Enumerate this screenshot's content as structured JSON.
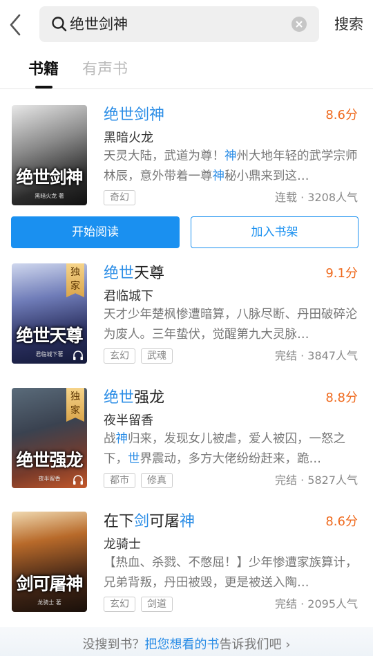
{
  "search": {
    "query": "绝世剑神",
    "button_label": "搜索"
  },
  "tabs": [
    {
      "label": "书籍"
    },
    {
      "label": "有声书"
    }
  ],
  "books": [
    {
      "title_parts": [
        {
          "text": "绝世剑神",
          "hl": true
        }
      ],
      "score": "8.6分",
      "author": "黑暗火龙",
      "desc_parts": [
        {
          "text": "天灵大陆，武道为尊！",
          "hl": false
        },
        {
          "text": "神",
          "hl": true
        },
        {
          "text": "州大地年轻的武学宗师林辰，意外带着一尊",
          "hl": false
        },
        {
          "text": "神",
          "hl": true
        },
        {
          "text": "秘小鼎来到这…",
          "hl": false
        }
      ],
      "tags": [
        "奇幻"
      ],
      "stats": "连载 · 3208人气",
      "cover_title": "绝世剑神",
      "cover_author": "黑暗火龙 著",
      "exclusive": false,
      "audio": false
    },
    {
      "title_parts": [
        {
          "text": "绝世",
          "hl": true
        },
        {
          "text": "天尊",
          "hl": false
        }
      ],
      "score": "9.1分",
      "author": "君临城下",
      "desc_parts": [
        {
          "text": "天才少年楚枫惨遭暗算，八脉尽断、丹田破碎沦为废人。三年蛰伏，觉醒第九大灵脉…",
          "hl": false
        }
      ],
      "tags": [
        "玄幻",
        "武魂"
      ],
      "stats": "完结 · 3847人气",
      "cover_title": "绝世天尊",
      "cover_author": "君临城下著",
      "exclusive": true,
      "exclusive_label": "独家",
      "audio": true
    },
    {
      "title_parts": [
        {
          "text": "绝世",
          "hl": true
        },
        {
          "text": "强龙",
          "hl": false
        }
      ],
      "score": "8.8分",
      "author": "夜半留香",
      "desc_parts": [
        {
          "text": "战",
          "hl": false
        },
        {
          "text": "神",
          "hl": true
        },
        {
          "text": "归来，发现女儿被虐，爱人被囚，一怒之下，",
          "hl": false
        },
        {
          "text": "世",
          "hl": true
        },
        {
          "text": "界震动，多方大佬纷纷赶来，跪…",
          "hl": false
        }
      ],
      "tags": [
        "都市",
        "修真"
      ],
      "stats": "完结 · 5827人气",
      "cover_title": "绝世强龙",
      "cover_author": "夜半留香",
      "exclusive": true,
      "exclusive_label": "独家",
      "audio": true
    },
    {
      "title_parts": [
        {
          "text": "在下",
          "hl": false
        },
        {
          "text": "剑",
          "hl": true
        },
        {
          "text": "可屠",
          "hl": false
        },
        {
          "text": "神",
          "hl": true
        }
      ],
      "score": "8.6分",
      "author": "龙骑士",
      "desc_parts": [
        {
          "text": "【热血、杀戮、不憋屈！】少年惨遭家族算计，兄弟背叛，丹田被毁，更是被送入陶…",
          "hl": false
        }
      ],
      "tags": [
        "玄幻",
        "剑道"
      ],
      "stats": "完结 · 2095人气",
      "cover_title": "剑可屠神",
      "cover_author": "龙骑士 著",
      "exclusive": false,
      "audio": false
    }
  ],
  "actions": {
    "read_label": "开始阅读",
    "shelf_label": "加入书架"
  },
  "footer": {
    "prefix": "没搜到书？",
    "link_text": "把您想看的书",
    "suffix": "告诉我们吧 ›"
  },
  "colors": {
    "accent": "#2b8de6",
    "primary_button": "#1a90f0",
    "score": "#ef6a1e"
  },
  "icons": {
    "back": "chevron-left-icon",
    "search": "search-icon",
    "clear": "close-icon",
    "audio": "headphone-icon"
  }
}
